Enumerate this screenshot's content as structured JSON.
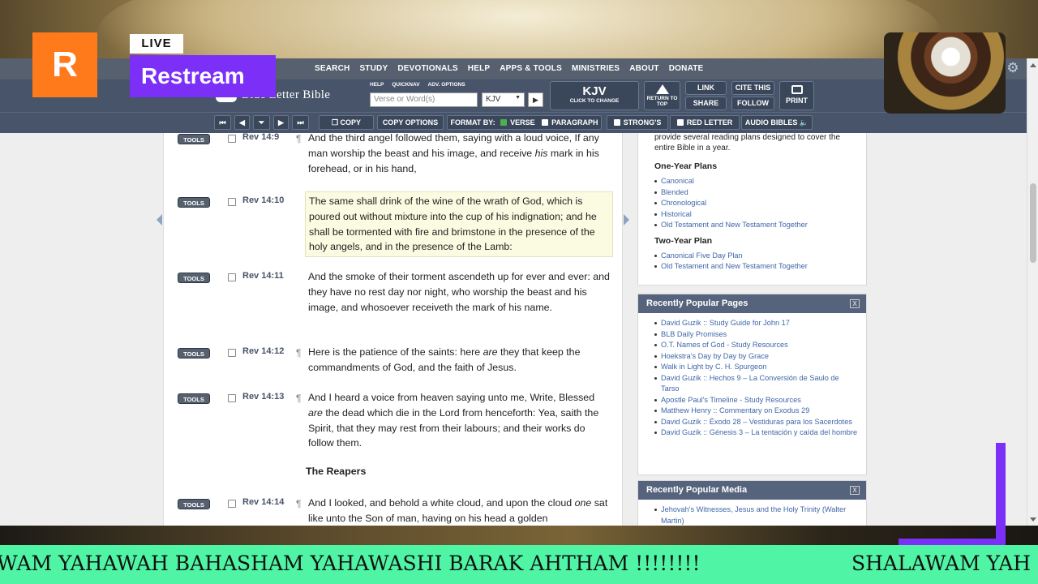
{
  "topnav": [
    "SEARCH",
    "STUDY",
    "DEVOTIONALS",
    "HELP",
    "APPS & TOOLS",
    "MINISTRIES",
    "ABOUT",
    "DONATE"
  ],
  "brand": "Blue Letter Bible",
  "mini_links": [
    "HELP",
    "QUICKNAV",
    "ADV. OPTIONS"
  ],
  "search": {
    "placeholder": "Verse or Word(s)",
    "version": "KJV"
  },
  "version_button": {
    "label": "KJV",
    "sub": "CLICK TO CHANGE"
  },
  "return_top": "RETURN TO TOP",
  "toolbar_buttons": {
    "link": "LINK",
    "cite": "CITE THIS",
    "share": "SHARE",
    "follow": "FOLLOW",
    "print": "PRINT"
  },
  "toolbar2": {
    "copy": "COPY",
    "copy_options": "COPY OPTIONS",
    "format_by": "FORMAT BY:",
    "verse": "VERSE",
    "paragraph": "PARAGRAPH",
    "strongs": "STRONG'S",
    "red_letter": "RED LETTER",
    "audio": "AUDIO BIBLES"
  },
  "tools_label": "TOOLS",
  "verses": [
    {
      "ref": "Rev 14:9",
      "para": true,
      "pre": "And the third angel followed them, saying with a loud voice, If any man worship the beast and his image, and receive ",
      "em": "his",
      "post": " mark in his forehead, or in his hand,"
    },
    {
      "ref": "Rev 14:10",
      "para": false,
      "pre": "The same shall drink of the wine of the wrath of God, which is poured out without mixture into the cup of his indignation; and he shall be tormented with fire and brimstone in the presence of the holy angels, and in the presence of the Lamb:",
      "em": "",
      "post": ""
    },
    {
      "ref": "Rev 14:11",
      "para": false,
      "pre": "And the smoke of their torment ascendeth up for ever and ever: and they have no rest day nor night, who worship the beast and his image, and whosoever receiveth the mark of his name.",
      "em": "",
      "post": ""
    },
    {
      "ref": "Rev 14:12",
      "para": true,
      "pre": "Here is the patience of the saints: here ",
      "em": "are",
      "post": " they that keep the commandments of God, and the faith of Jesus."
    },
    {
      "ref": "Rev 14:13",
      "para": true,
      "pre": "And I heard a voice from heaven saying unto me, Write, Blessed ",
      "em": "are",
      "post": " the dead which die in the Lord from henceforth: Yea, saith the Spirit, that they may rest from their labours; and their works do follow them."
    },
    {
      "ref": "Rev 14:14",
      "para": true,
      "pre": "And I looked, and behold a white cloud, and upon the cloud ",
      "em": "one",
      "post": " sat like unto the Son of man, having on his head a golden"
    }
  ],
  "section_heading": "The Reapers",
  "reading_plans": {
    "intro": "provide several reading plans designed to cover the entire Bible in a year.",
    "one_year_title": "One-Year Plans",
    "one_year": [
      "Canonical",
      "Blended",
      "Chronological",
      "Historical",
      "Old Testament and New Testament Together"
    ],
    "two_year_title": "Two-Year Plan",
    "two_year": [
      "Canonical Five Day Plan",
      "Old Testament and New Testament Together"
    ]
  },
  "popular_pages": {
    "title": "Recently Popular Pages",
    "items": [
      "David Guzik :: Study Guide for John 17",
      "BLB Daily Promises",
      "O.T. Names of God - Study Resources",
      "Hoekstra's Day by Day by Grace",
      "Walk in Light by C. H. Spurgeon",
      "David Guzik :: Hechos 9 – La Conversión de Saulo de Tarso",
      "Apostle Paul's Timeline - Study Resources",
      "Matthew Henry :: Commentary on Exodus 29",
      "David Guzik :: Éxodo 28 – Vestiduras para los Sacerdotes",
      "David Guzik :: Génesis 3 – La tentación y caída del hombre"
    ]
  },
  "popular_media": {
    "title": "Recently Popular Media",
    "items": [
      "Jehovah's Witnesses, Jesus and the Holy Trinity (Walter Martin)"
    ]
  },
  "close_glyph": "X",
  "restream": {
    "logo": "R",
    "live": "LIVE",
    "name": "Restream"
  },
  "ticker": {
    "text_a": "WAM YAHAWAH BAHASHAM YAHAWASHI BARAK AHTHAM !!!!!!!!",
    "text_b": "SHALAWAM YAH"
  },
  "colors": {
    "nav": "#56606f",
    "toolbar": "#47546a",
    "panel_head": "#56637d",
    "link": "#3f67a8",
    "restream_orange": "#ff7a1a",
    "restream_purple": "#7b2ff7",
    "ticker": "#4ff5a5"
  }
}
